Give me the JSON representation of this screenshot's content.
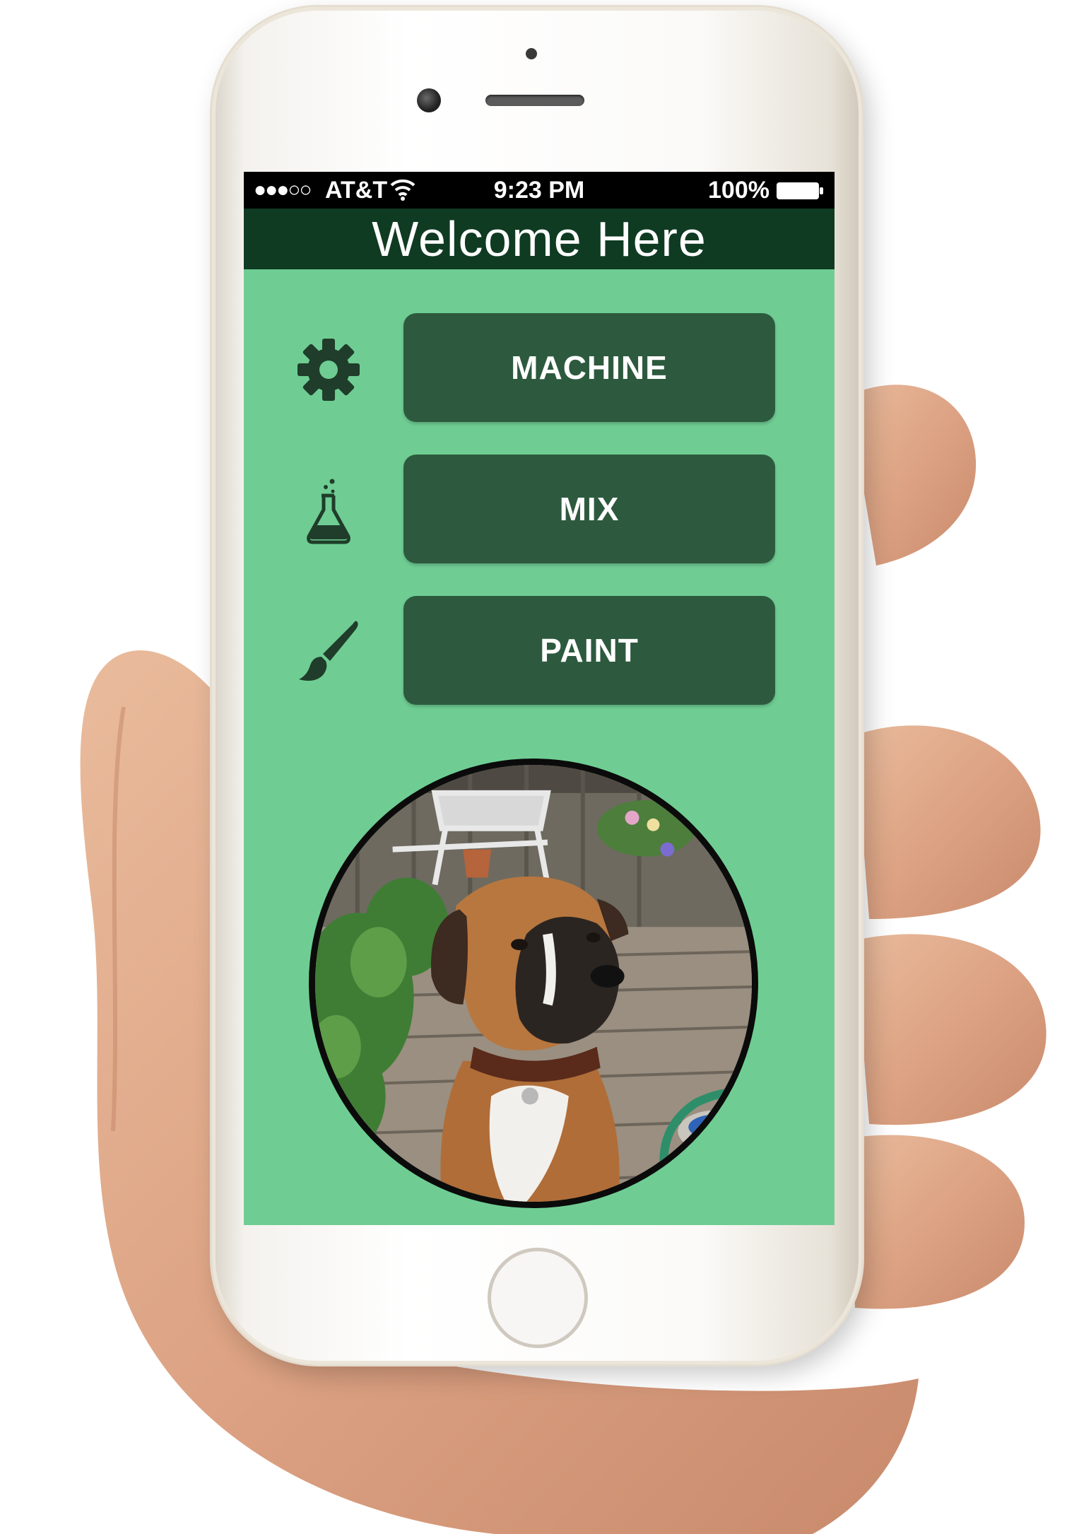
{
  "status_bar": {
    "signal": "●●●○○",
    "carrier": "AT&T",
    "time": "9:23 PM",
    "battery": "100%"
  },
  "header": {
    "title": "Welcome Here"
  },
  "menu": [
    {
      "label": "MACHINE",
      "icon": "gear-icon"
    },
    {
      "label": "MIX",
      "icon": "flask-icon"
    },
    {
      "label": "PAINT",
      "icon": "paintbrush-icon"
    }
  ],
  "photo": {
    "subject": "dog-photo"
  },
  "colors": {
    "screen_background": "#6fcd93",
    "header_background": "#0f3b22",
    "button_background": "#2d5a3e",
    "icon_color": "#1f3d2a"
  }
}
